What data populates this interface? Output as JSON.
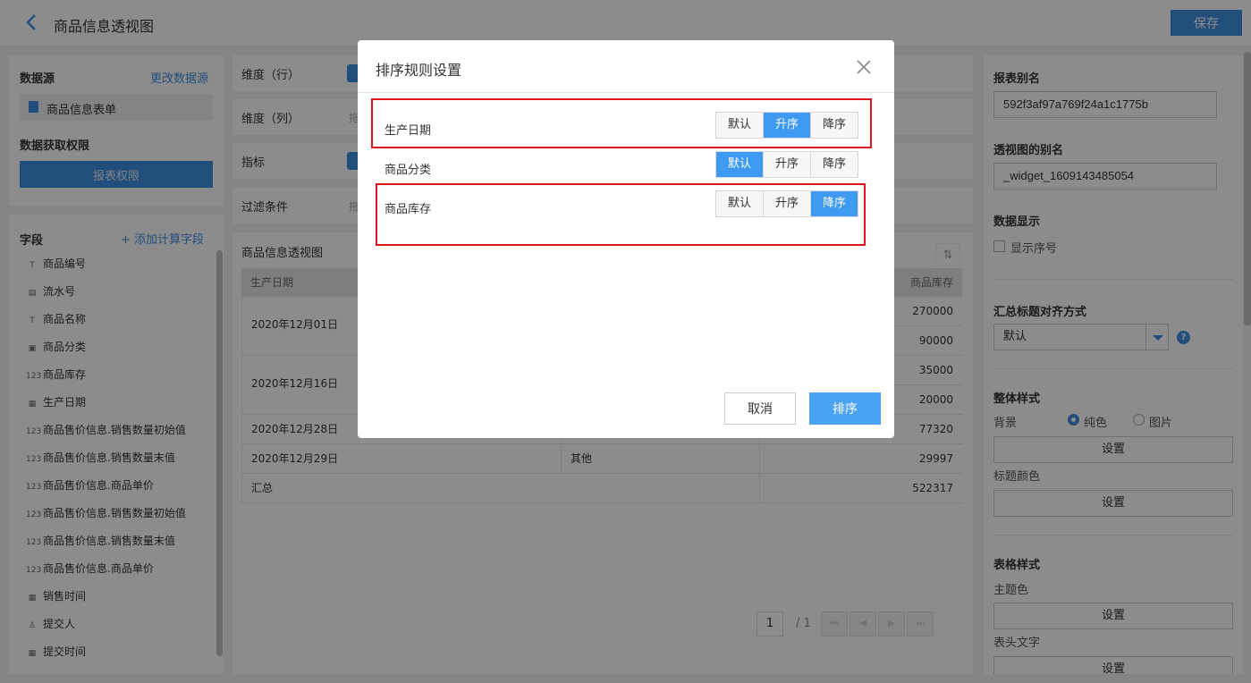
{
  "header": {
    "title": "商品信息透视图",
    "save_label": "保存"
  },
  "left": {
    "datasource_title": "数据源",
    "change_datasource": "更改数据源",
    "datasource_name": "商品信息表单",
    "permission_title": "数据获取权限",
    "permission_button": "报表权限",
    "fields_title": "字段",
    "add_calc_field": "+ 添加计算字段",
    "fields": [
      {
        "icon": "T",
        "label": "商品编号"
      },
      {
        "icon": "▤",
        "label": "流水号"
      },
      {
        "icon": "T",
        "label": "商品名称"
      },
      {
        "icon": "▣",
        "label": "商品分类"
      },
      {
        "icon": "123",
        "label": "商品库存"
      },
      {
        "icon": "▦",
        "label": "生产日期"
      },
      {
        "icon": "123",
        "label": "商品售价信息.销售数量初始值"
      },
      {
        "icon": "123",
        "label": "商品售价信息.销售数量末值"
      },
      {
        "icon": "123",
        "label": "商品售价信息.商品单价"
      },
      {
        "icon": "123",
        "label": "商品售价信息.销售数量初始值"
      },
      {
        "icon": "123",
        "label": "商品售价信息.销售数量末值"
      },
      {
        "icon": "123",
        "label": "商品售价信息.商品单价"
      },
      {
        "icon": "▦",
        "label": "销售时间"
      },
      {
        "icon": "♙",
        "label": "提交人"
      },
      {
        "icon": "▦",
        "label": "提交时间"
      }
    ]
  },
  "center": {
    "rows": [
      {
        "label": "维度（行）"
      },
      {
        "label": "维度（列）",
        "ghost": "拖"
      },
      {
        "label": "指标"
      },
      {
        "label": "过滤条件",
        "ghost": "拖"
      }
    ],
    "table_title": "商品信息透视图",
    "headers": {
      "date": "生产日期",
      "stock": "商品库存"
    },
    "groups": [
      {
        "date": "2020年12月01日",
        "values": [
          "270000",
          "90000"
        ]
      },
      {
        "date": "2020年12月16日",
        "values": [
          "35000",
          "20000"
        ]
      },
      {
        "date": "2020年12月28日",
        "values": [
          "77320"
        ]
      },
      {
        "date": "2020年12月29日",
        "category": "其他",
        "values": [
          "29997"
        ]
      }
    ],
    "total_label": "汇总",
    "total_value": "522317",
    "pager": {
      "page": "1",
      "total": "/ 1"
    }
  },
  "right": {
    "alias_label": "报表别名",
    "alias_value": "592f3af97a769f24a1c1775b",
    "widget_alias_label": "透视图的别名",
    "widget_alias_value": "_widget_1609143485054",
    "data_display_label": "数据显示",
    "show_index_label": "显示序号",
    "summary_align_label": "汇总标题对齐方式",
    "summary_align_value": "默认",
    "overall_style_label": "整体样式",
    "background_label": "背景",
    "bg_solid": "纯色",
    "bg_image": "图片",
    "set_label": "设置",
    "title_color_label": "标题颜色",
    "table_style_label": "表格样式",
    "theme_color_label": "主题色",
    "header_text_label": "表头文字"
  },
  "modal": {
    "title": "排序规则设置",
    "options": [
      "默认",
      "升序",
      "降序"
    ],
    "rows": [
      {
        "label": "生产日期",
        "selected": 1
      },
      {
        "label": "商品分类",
        "selected": 0
      },
      {
        "label": "商品库存",
        "selected": 2
      }
    ],
    "cancel_label": "取消",
    "confirm_label": "排序"
  },
  "colors": {
    "accent": "#3d8fe0",
    "highlight": "#e0141e"
  }
}
